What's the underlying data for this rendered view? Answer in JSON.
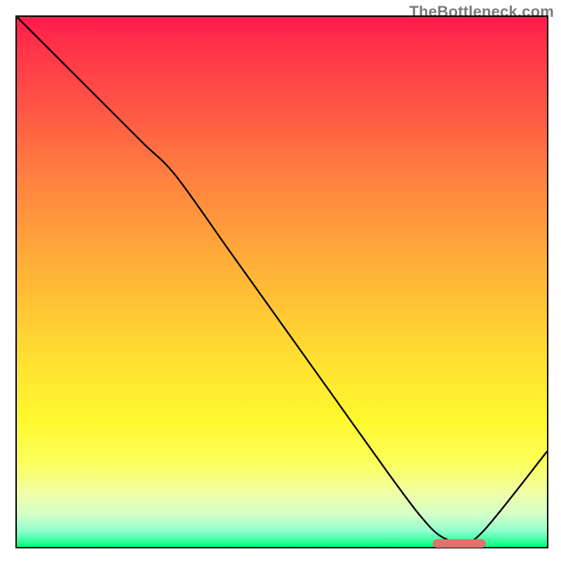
{
  "watermark": "TheBottleneck.com",
  "chart_data": {
    "type": "line",
    "title": "",
    "xlabel": "",
    "ylabel": "",
    "xlim": [
      0,
      100
    ],
    "ylim": [
      0,
      100
    ],
    "grid": false,
    "legend": false,
    "series": [
      {
        "name": "bottleneck-curve",
        "x": [
          0,
          8,
          18,
          24,
          30,
          40,
          50,
          60,
          70,
          76,
          80,
          84,
          88,
          100
        ],
        "y": [
          100,
          92,
          82,
          76,
          70,
          56,
          42,
          28,
          14,
          6,
          2,
          1,
          3,
          18
        ]
      }
    ],
    "optimal_band": {
      "x_start": 78,
      "x_end": 88,
      "y": 1.2
    },
    "gradient_stops": [
      {
        "pct": 0,
        "color": "#ff1a4d"
      },
      {
        "pct": 18,
        "color": "#ff5844"
      },
      {
        "pct": 42,
        "color": "#ffa23a"
      },
      {
        "pct": 66,
        "color": "#ffe331"
      },
      {
        "pct": 84,
        "color": "#fcff5a"
      },
      {
        "pct": 97,
        "color": "#8effce"
      },
      {
        "pct": 100,
        "color": "#09f07a"
      }
    ]
  }
}
